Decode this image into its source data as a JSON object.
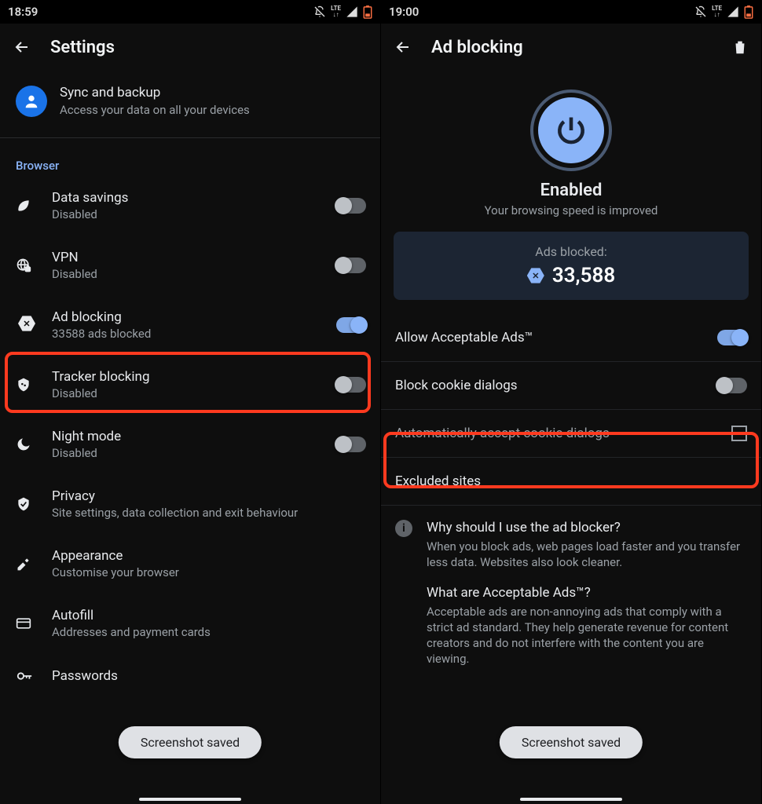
{
  "left": {
    "status_time": "18:59",
    "title": "Settings",
    "sync": {
      "title": "Sync and backup",
      "subtitle": "Access your data on all your devices"
    },
    "browser_label": "Browser",
    "items": [
      {
        "title": "Data savings",
        "subtitle": "Disabled",
        "toggle": false
      },
      {
        "title": "VPN",
        "subtitle": "Disabled",
        "toggle": false
      },
      {
        "title": "Ad blocking",
        "subtitle": "33588 ads blocked",
        "toggle": true
      },
      {
        "title": "Tracker blocking",
        "subtitle": "Disabled",
        "toggle": false
      },
      {
        "title": "Night mode",
        "subtitle": "Disabled",
        "toggle": false
      },
      {
        "title": "Privacy",
        "subtitle": "Site settings, data collection and exit behaviour"
      },
      {
        "title": "Appearance",
        "subtitle": "Customise your browser"
      },
      {
        "title": "Autofill",
        "subtitle": "Addresses and payment cards"
      },
      {
        "title": "Passwords",
        "subtitle": ""
      }
    ],
    "toast": "Screenshot saved"
  },
  "right": {
    "status_time": "19:00",
    "title": "Ad blocking",
    "enabled_label": "Enabled",
    "enabled_sub": "Your browsing speed is improved",
    "stats_label": "Ads blocked:",
    "stats_value": "33,588",
    "allow_ads": "Allow Acceptable Ads™",
    "cookie_block": "Block cookie dialogs",
    "cookie_auto": "Automatically accept cookie dialogs",
    "excluded": "Excluded sites",
    "faq1_q": "Why should I use the ad blocker?",
    "faq1_a": "When you block ads, web pages load faster and you transfer less data. Websites also look cleaner.",
    "faq2_q": "What are Acceptable Ads™?",
    "faq2_a": "Acceptable ads are non-annoying ads that comply with a strict ad standard. They help generate revenue for content creators and do not interfere with the content you are viewing.",
    "toast": "Screenshot saved"
  }
}
